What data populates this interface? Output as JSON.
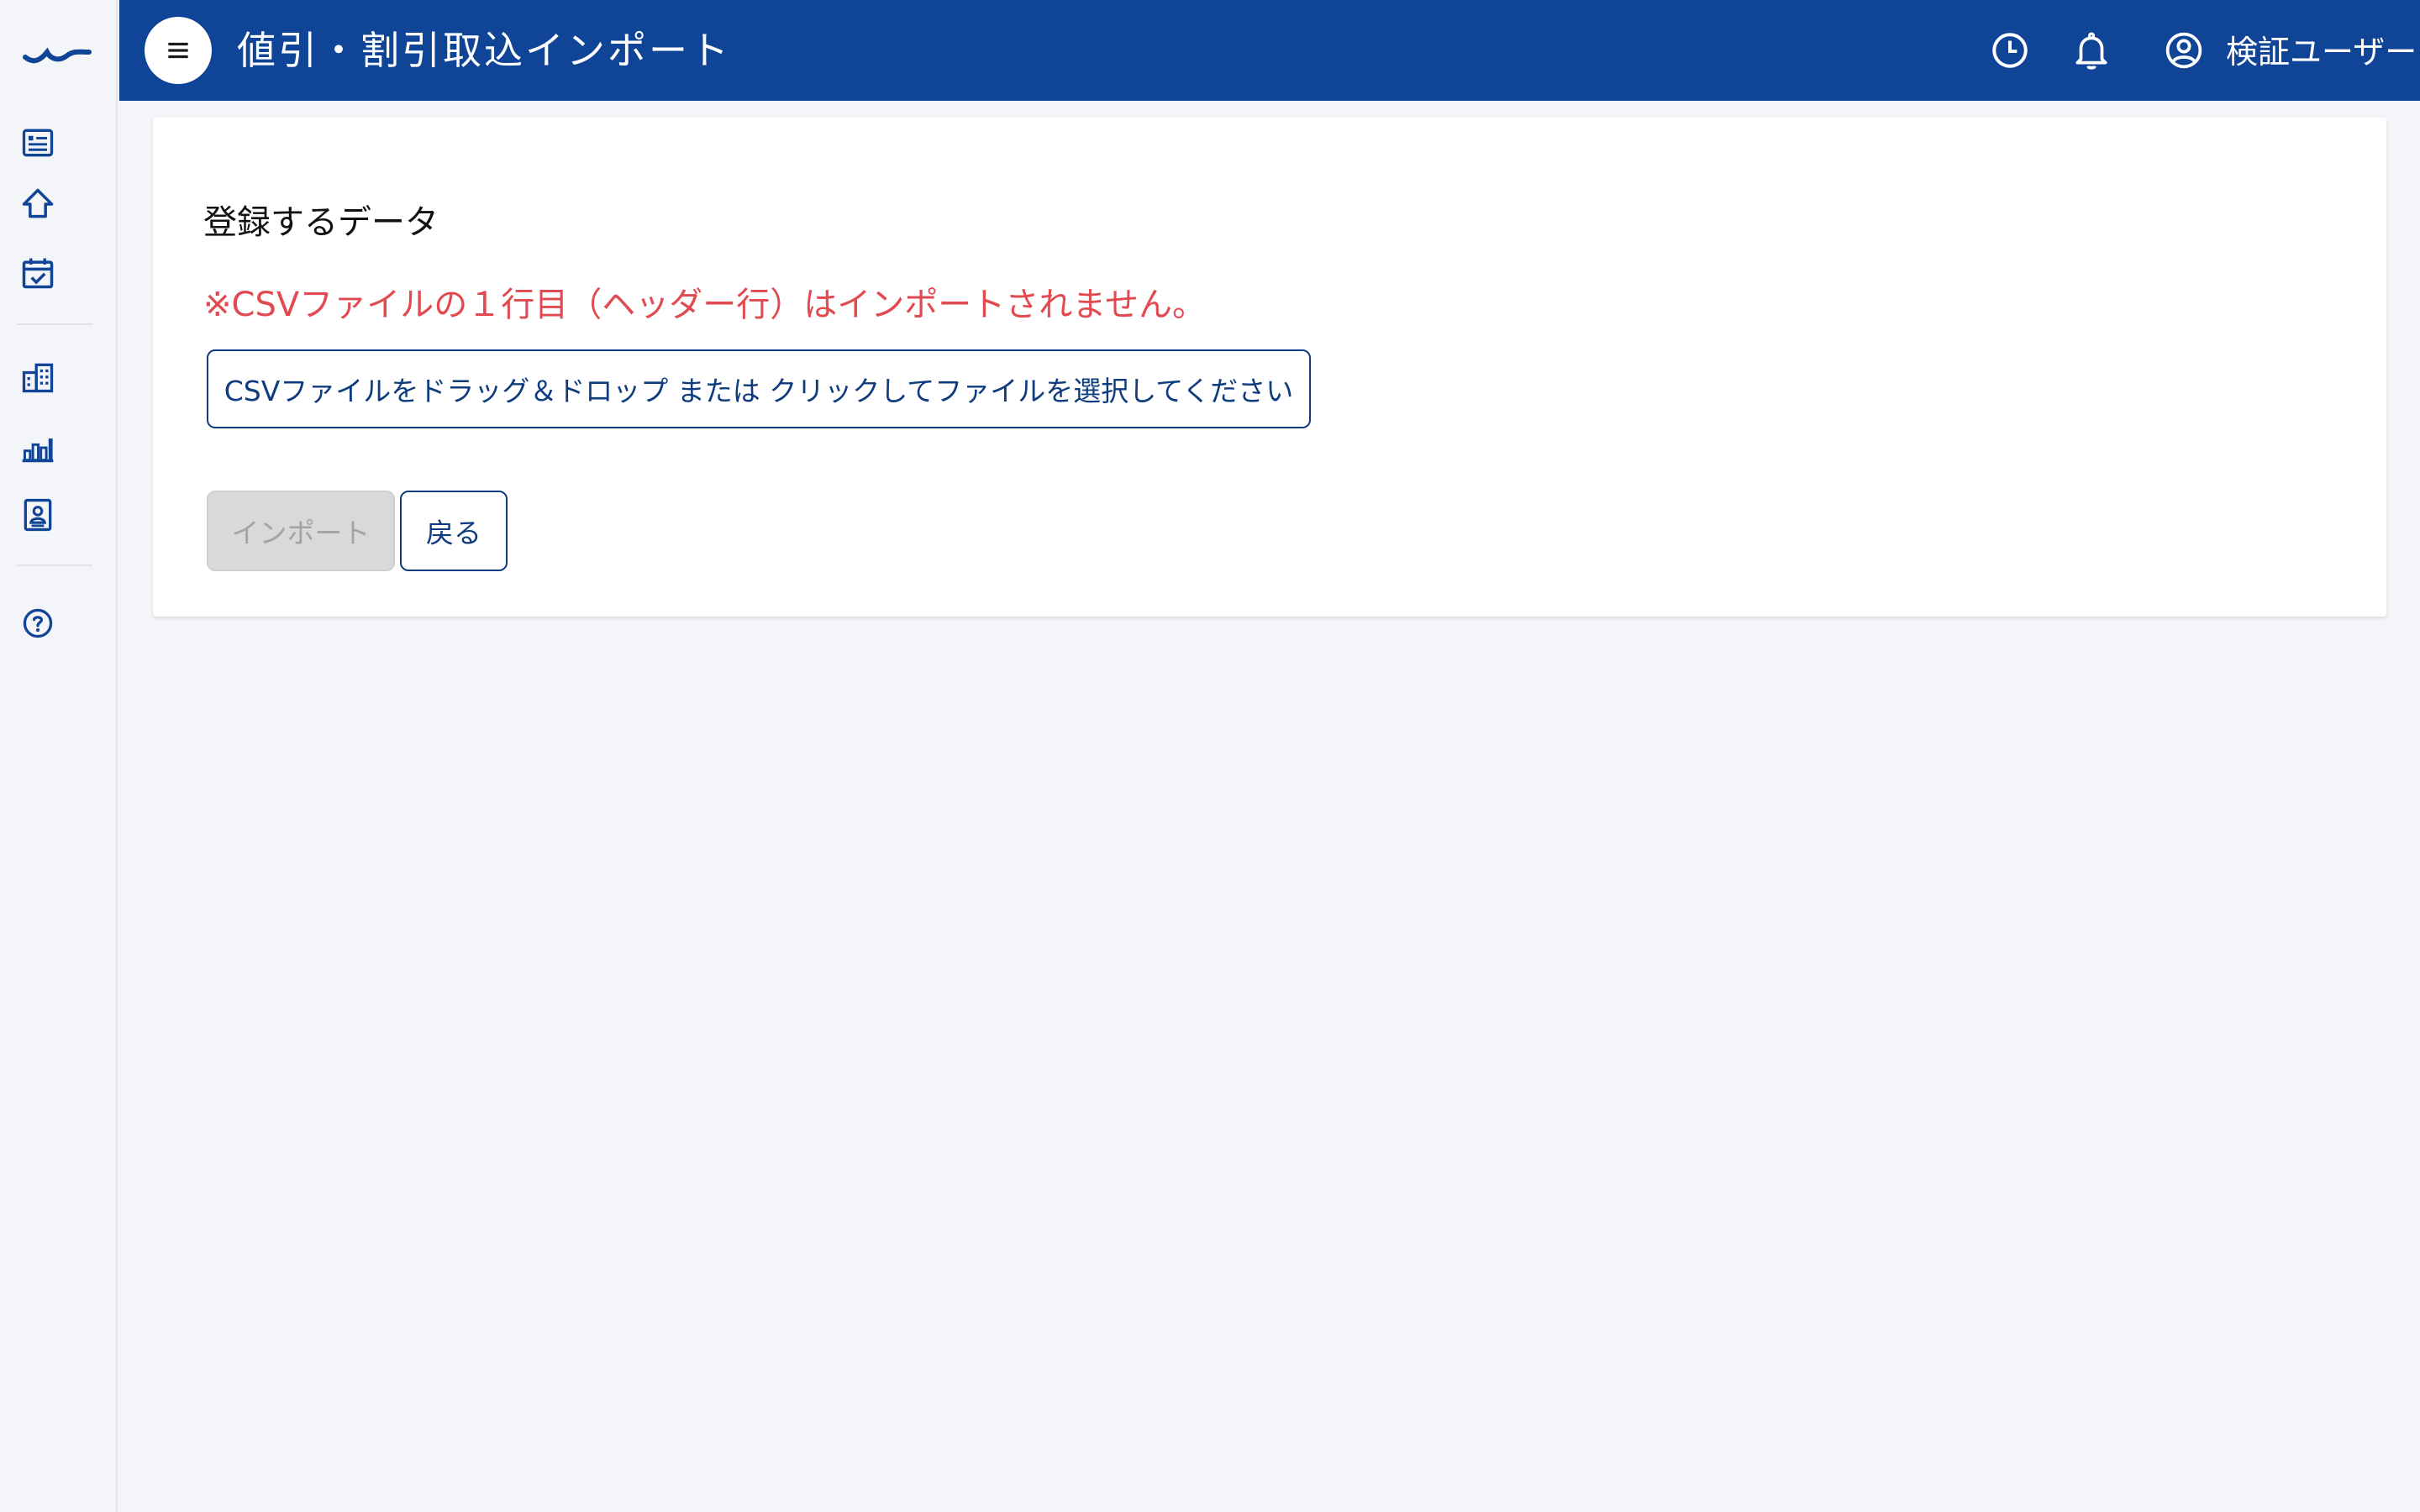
{
  "colors": {
    "header_bg": "#0f4496",
    "primary": "#0f3c7e",
    "warning": "#e24a52",
    "page_bg": "#f3f5f8",
    "disabled_bg": "#d9d9d9",
    "disabled_text": "#a4a4a4"
  },
  "sidebar": {
    "logo_icon": "wave-logo",
    "items": [
      {
        "icon": "list-document-icon"
      },
      {
        "icon": "home-icon"
      },
      {
        "icon": "calendar-check-icon"
      },
      {
        "icon": "building-icon"
      },
      {
        "icon": "bar-chart-icon"
      },
      {
        "icon": "id-card-icon"
      },
      {
        "icon": "help-circle-icon"
      }
    ]
  },
  "header": {
    "menu_icon": "hamburger-menu-icon",
    "title": "値引・割引取込インポート",
    "history_icon": "clock-icon",
    "notification_icon": "bell-icon",
    "user_icon": "user-circle-icon",
    "user_name": "検証ユーザー"
  },
  "main": {
    "section_title": "登録するデータ",
    "warning": "※CSVファイルの１行目（ヘッダー行）はインポートされません。",
    "dropzone_label": "CSVファイルをドラッグ＆ドロップ または クリックしてファイルを選択してください",
    "import_button": "インポート",
    "import_disabled": true,
    "back_button": "戻る"
  }
}
